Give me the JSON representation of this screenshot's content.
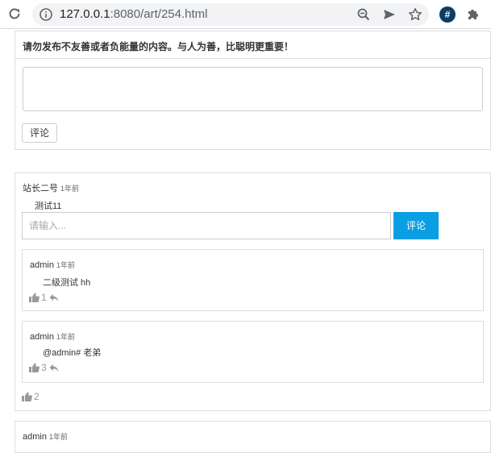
{
  "browser": {
    "url_host": "127.0.0.1",
    "url_rest": ":8080/art/254.html",
    "icons": {
      "reload": "reload-icon",
      "info": "info-icon",
      "zoom": "zoom-icon",
      "send": "send-icon",
      "bookmark": "star-icon",
      "extension_hash": "hash-extension-icon",
      "extensions": "puzzle-icon"
    },
    "extension_label": "#"
  },
  "comment_form": {
    "notice": "请勿发布不友善或者负能量的内容。与人为善，比聪明更重要！",
    "textarea_value": "",
    "submit_label": "评论"
  },
  "comments": [
    {
      "author": "站长二号",
      "time": "1年前",
      "content": "测试11",
      "reply_input": {
        "value": "",
        "placeholder": "请输入..."
      },
      "reply_button_label": "评论",
      "likes": "2",
      "replies": [
        {
          "author": "admin",
          "time": "1年前",
          "content": "二级测试 hh",
          "likes": "1"
        },
        {
          "author": "admin",
          "time": "1年前",
          "content": "@admin# 老弟",
          "likes": "3"
        }
      ]
    },
    {
      "author": "admin",
      "time": "1年前"
    }
  ],
  "colors": {
    "primary_button": "#0a9fe3",
    "border": "#dddddd",
    "muted_icon": "#999999"
  }
}
